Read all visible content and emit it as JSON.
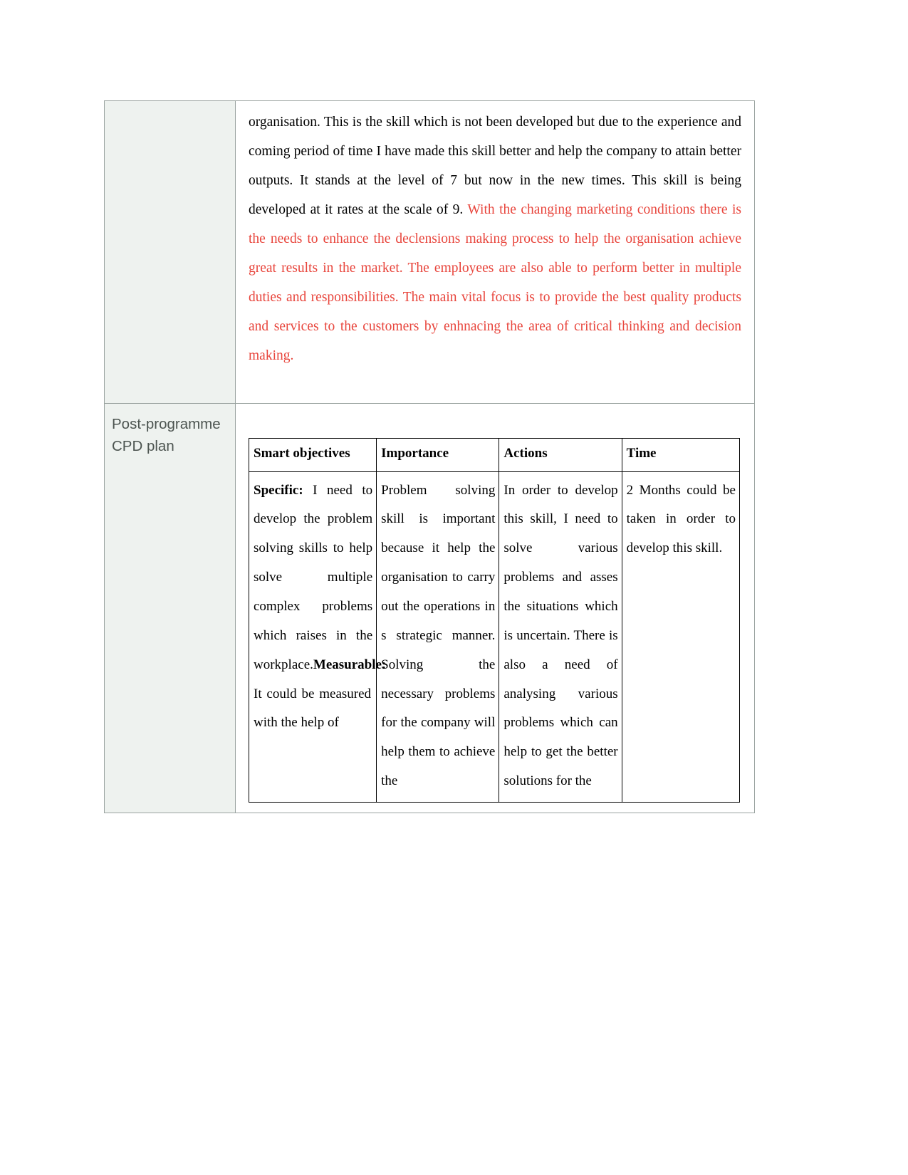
{
  "document": {
    "section_label": "Post-programme CPD plan",
    "body_paragraph": {
      "black_text": "organisation. This is the skill which is not been developed but due to the experience and coming period of time I have made this skill better and help the company to attain better outputs. It stands at the level of 7 but now in the new times. This skill is being developed at it rates at the scale of 9. ",
      "red_text": "With the changing marketing conditions there is the needs to enhance the declensions making process to help the organisation achieve great results in the market. The employees are also able to perform better in multiple duties and responsibilities. The main vital focus is to provide the best quality products and services to the customers by enhnacing the area of critical thinking and decision making.",
      "red_color": "#e8453c"
    },
    "cpd_table": {
      "headers": {
        "smart_objectives": "Smart objectives",
        "importance": "Importance",
        "actions": "Actions",
        "time": "Time"
      },
      "rows": [
        {
          "smart_objectives_label_1": "Specific:",
          "smart_objectives_text_1": " I need to develop the problem solving skills to help solve multiple complex problems which raises in the workplace.",
          "smart_objectives_label_2": "Measurable:",
          "smart_objectives_text_2": " It could be measured with the help of",
          "importance": "Problem solving skill is important because it help the organisation to carry out the operations in s strategic manner. Solving the necessary problems for the company will help them to achieve the",
          "actions": "In order to develop this skill, I need to solve various problems and asses the situations which is uncertain. There is also a need of analysing various problems which can help to get the better solutions for the",
          "time": "2 Months could be taken in order to develop this skill."
        }
      ]
    }
  }
}
